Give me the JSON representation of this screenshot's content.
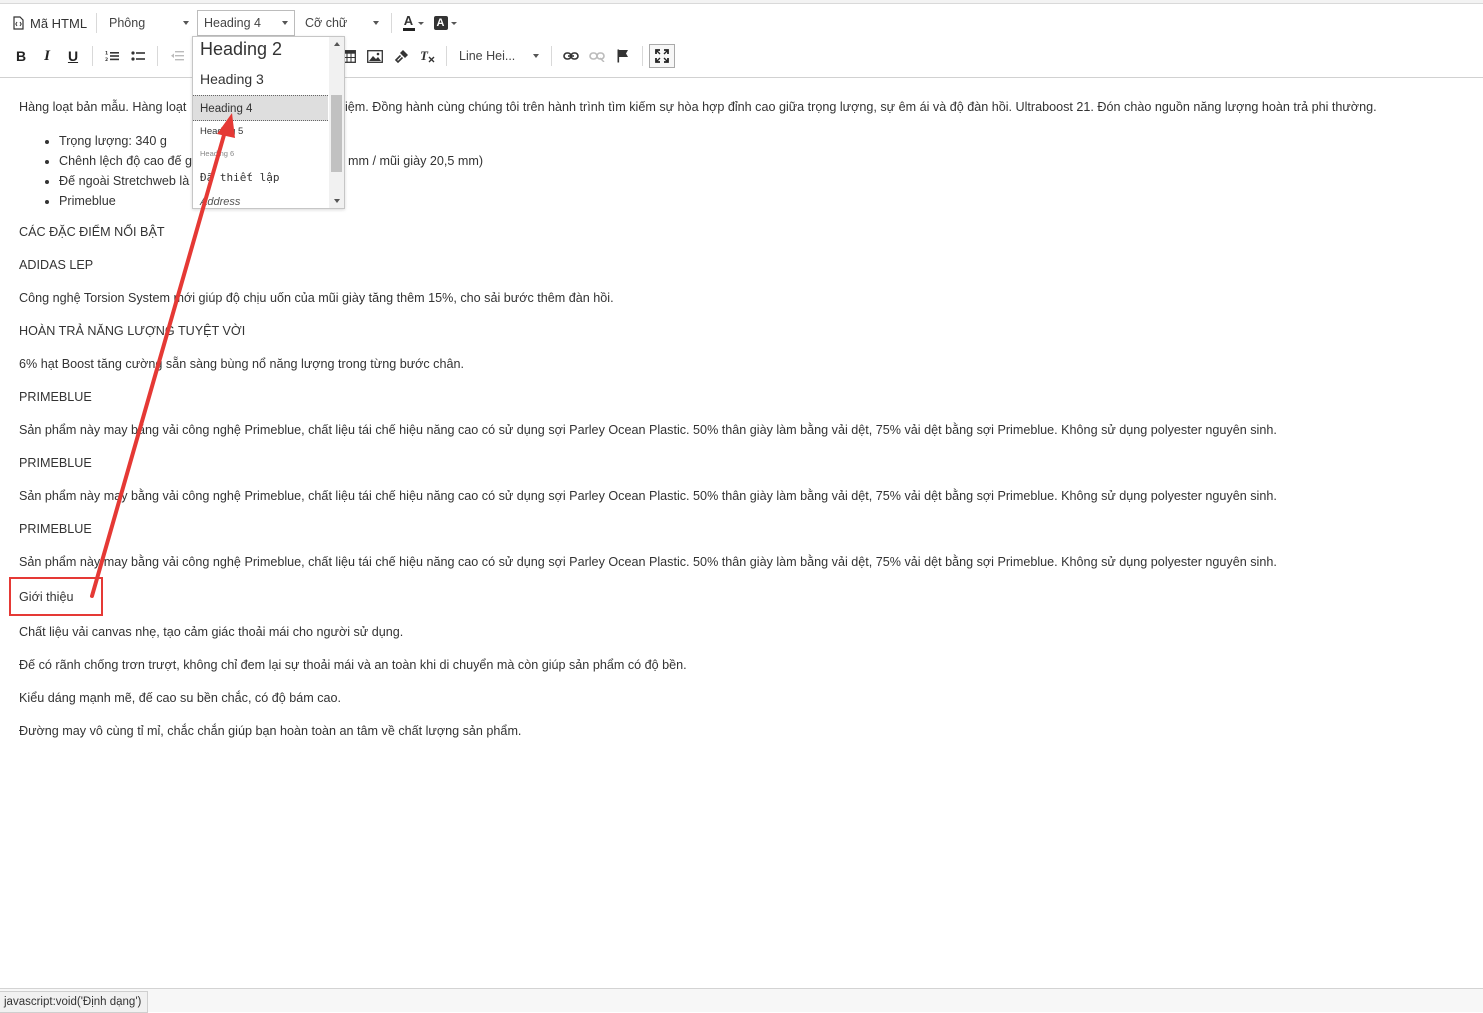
{
  "toolbar": {
    "source_label": "Mã HTML",
    "font_combo": "Phông",
    "format_combo": "Heading 4",
    "size_combo": "Cỡ chữ",
    "line_height_combo": "Line Hei...",
    "text_color_glyph": "A",
    "bg_color_glyph": "A",
    "bold": "B",
    "italic": "I",
    "underline": "U"
  },
  "format_dropdown": {
    "items": [
      "Heading 2",
      "Heading 3",
      "Heading 4",
      "Heading 5",
      "Heading 6",
      "Đã thiết lập",
      "Address"
    ],
    "selected": "Heading 4"
  },
  "content": {
    "intro": "Hàng loạt bản mẫu. Hàng loạt ... nhiệm. Đồng hành cùng chúng tôi trên hành trình tìm kiếm sự hòa hợp đỉnh cao giữa trọng lượng, sự êm ái và độ đàn hồi. Ultraboost 21. Đón chào nguồn năng lượng hoàn trả phi thường.",
    "intro_a": "Hàng loạt bản mẫu. Hàng loạt",
    "intro_b": "nhiệm. Đồng hành cùng chúng tôi trên hành trình tìm kiếm sự hòa hợp đỉnh cao giữa trọng lượng, sự êm ái và độ đàn hồi. Ultraboost 21. Đón chào nguồn năng lượng hoàn trả phi thường.",
    "bullets": [
      "Trọng lượng: 340 g",
      "Chênh lệch độ cao đế g",
      "Đế ngoài Stretchweb là",
      "Primeblue"
    ],
    "bullet2_tail": "mm / mũi giày 20,5 mm)",
    "h_features": "CÁC ĐẶC ĐIỂM NỔI BẬT",
    "h_lep": "ADIDAS LEP",
    "p_torsion": "Công nghệ Torsion System mới giúp độ chịu uốn của mũi giày tăng thêm 15%, cho sải bước thêm đàn hồi.",
    "h_energy": "HOÀN TRẢ NĂNG LƯỢNG TUYỆT VỜI",
    "p_boost": "6% hạt Boost tăng cường sẵn sàng bùng nổ năng lượng trong từng bước chân.",
    "h_prime1": "PRIMEBLUE",
    "p_prime1": "Sản phẩm này may bằng vải công nghệ Primeblue, chất liệu tái chế hiệu năng cao có sử dụng sợi Parley Ocean Plastic. 50% thân giày làm bằng vải dệt, 75% vải dệt bằng sợi Primeblue. Không sử dụng polyester nguyên sinh.",
    "h_prime2": "PRIMEBLUE",
    "p_prime2": "Sản phẩm này may bằng vải công nghệ Primeblue, chất liệu tái chế hiệu năng cao có sử dụng sợi Parley Ocean Plastic. 50% thân giày làm bằng vải dệt, 75% vải dệt bằng sợi Primeblue. Không sử dụng polyester nguyên sinh.",
    "h_prime3": "PRIMEBLUE",
    "p_prime3": "Sản phẩm này may bằng vải công nghệ Primeblue, chất liệu tái chế hiệu năng cao có sử dụng sợi Parley Ocean Plastic. 50% thân giày làm bằng vải dệt, 75% vải dệt bằng sợi Primeblue. Không sử dụng polyester nguyên sinh.",
    "h_intro": "Giới thiệu",
    "p_canvas": "Chất liệu vải canvas nhẹ, tạo cảm giác thoải mái cho người sử dụng.",
    "p_grip": "Đế có rãnh chống trơn trượt, không chỉ đem lại sự thoải mái và an toàn khi di chuyển mà còn giúp sản phẩm có độ bền.",
    "p_style": "Kiểu dáng mạnh mẽ, đế cao su bền chắc, có độ bám cao.",
    "p_stitch": "Đường may vô cùng tỉ mỉ, chắc chắn giúp bạn hoàn toàn an tâm về chất lượng sản phẩm."
  },
  "status": {
    "tooltip": "javascript:void('Định dạng')"
  },
  "colors": {
    "annotation": "#e53935"
  },
  "icons": [
    "source-icon",
    "numbered-list-icon",
    "bulleted-list-icon",
    "outdent-icon",
    "table-icon",
    "image-icon",
    "paint-format-icon",
    "remove-format-icon",
    "link-icon",
    "unlink-icon",
    "anchor-flag-icon",
    "maximize-icon"
  ]
}
